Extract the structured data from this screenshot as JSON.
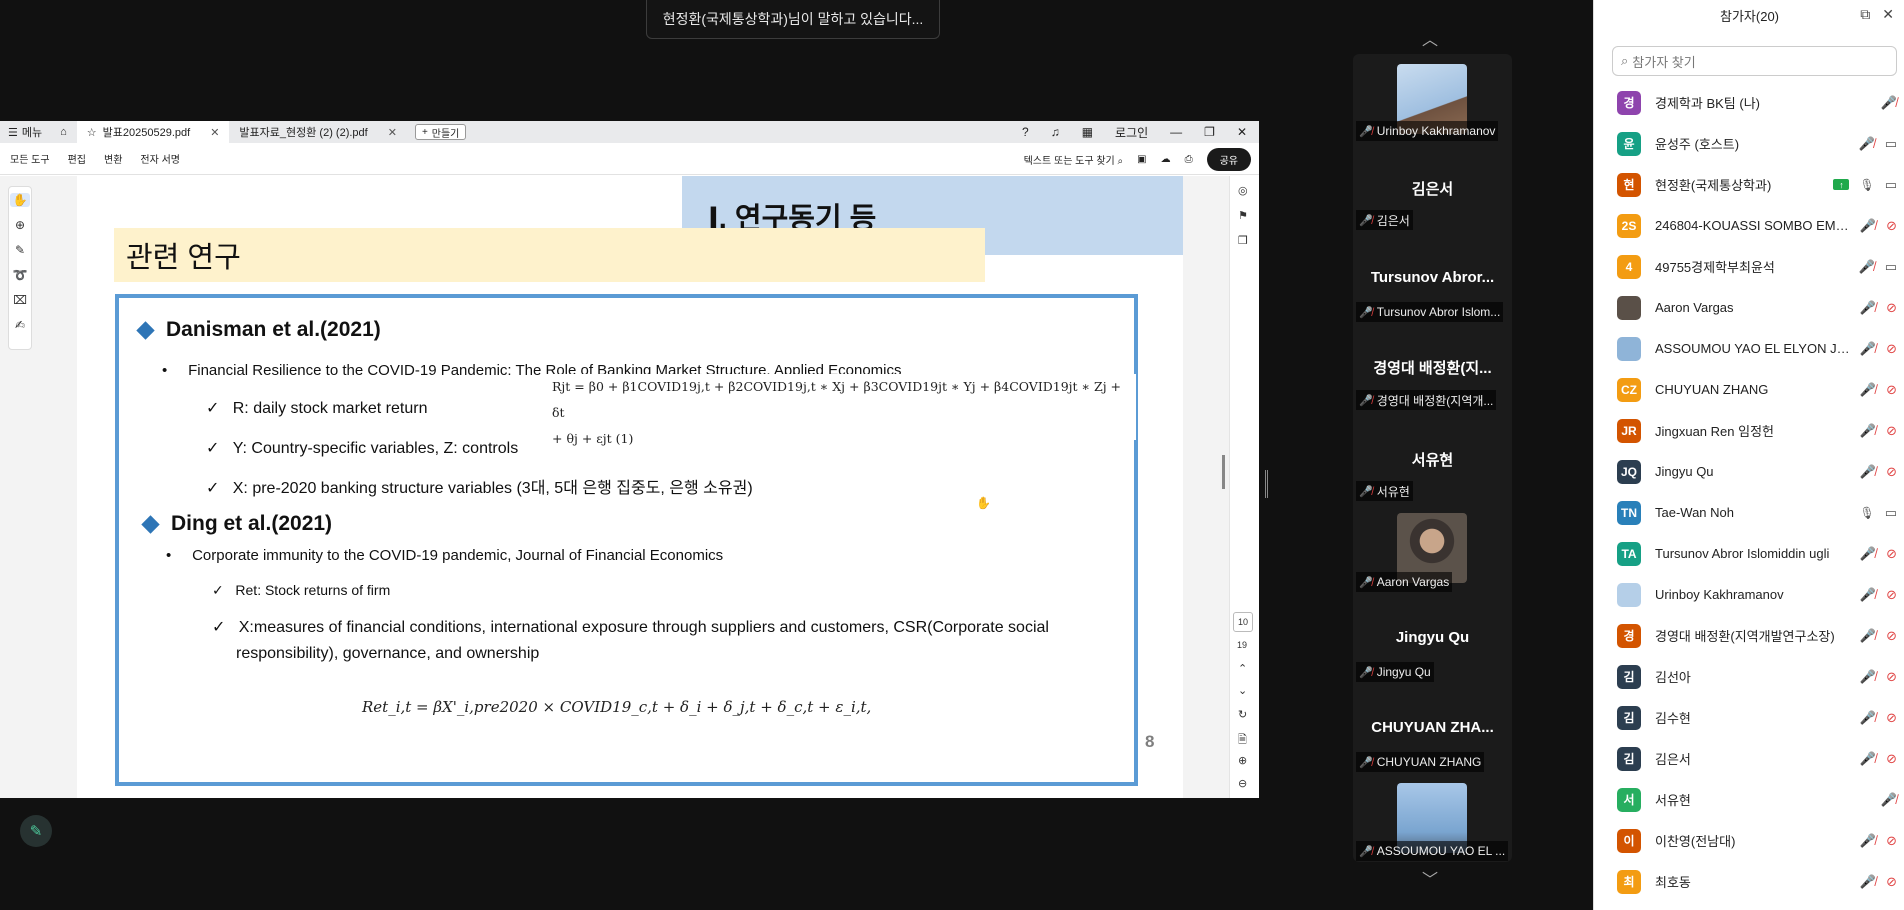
{
  "speaking_banner": "현정환(국제통상학과)님이 말하고 있습니다...",
  "pdf": {
    "menu_label": "메뉴",
    "tabs": [
      {
        "label": "발표20250529.pdf"
      },
      {
        "label": "발표자료_현정환 (2) (2).pdf"
      }
    ],
    "new_tab_label": "만들기",
    "login_label": "로그인",
    "toolbar_items": [
      "모든 도구",
      "편집",
      "변환",
      "전자 서명"
    ],
    "search_label": "텍스트 또는 도구 찾기",
    "share_label": "공유",
    "current_page": "10",
    "total_pages": "19"
  },
  "slide": {
    "title": "Ⅰ. 연구동기 등",
    "subtitle": "관련 연구",
    "section1_heading": "Danisman et al.(2021)",
    "section1_bullet": "Financial Resilience to the COVID-19 Pandemic: The Role of Banking Market Structure, Applied Economics",
    "section1_checks": [
      "R: daily stock market return",
      "Y: Country-specific variables,  Z: controls",
      "X: pre-2020 banking structure variables (3대, 5대 은행 집중도, 은행 소유권)"
    ],
    "equation_line1": "Rjt = β0 + β1COVID19j,t + β2COVID19j,t ∗ Xj + β3COVID19jt ∗ Yj + β4COVID19jt ∗ Zj + δt",
    "equation_line2": "+ θj + εjt   (1)",
    "section2_heading": "Ding et al.(2021)",
    "section2_bullet": "Corporate immunity to the COVID-19 pandemic, Journal of Financial Economics",
    "section2_check1": "Ret: Stock returns of firm",
    "section2_check2_a": "X:measures of financial conditions, international exposure through suppliers and customers, CSR(Corporate social",
    "section2_check2_b": "responsibility), governance, and ownership",
    "formula": "Ret_i,t = βX'_i,pre2020 × COVID19_c,t + δ_i + δ_j,t + δ_c,t + ε_i,t,",
    "page_number": "8"
  },
  "video_strip": [
    {
      "display_name": "",
      "label": "Urinboy Kakhramanov",
      "has_video": true,
      "thumb_color": "#b5cfe8"
    },
    {
      "display_name": "김은서",
      "label": "김은서",
      "has_video": false
    },
    {
      "display_name": "Tursunov  Abror...",
      "label": "Tursunov Abror Islom...",
      "has_video": false
    },
    {
      "display_name": "경영대 배정환(지...",
      "label": "경영대 배정환(지역개...",
      "has_video": false
    },
    {
      "display_name": "서유현",
      "label": "서유현",
      "has_video": false
    },
    {
      "display_name": "",
      "label": "Aaron Vargas",
      "has_video": true,
      "thumb_color": "#4a4038"
    },
    {
      "display_name": "Jingyu Qu",
      "label": "Jingyu Qu",
      "has_video": false
    },
    {
      "display_name": "CHUYUAN  ZHA...",
      "label": "CHUYUAN ZHANG",
      "has_video": false
    },
    {
      "display_name": "",
      "label": "ASSOUMOU YAO EL ...",
      "has_video": true,
      "thumb_color": "#8fb4d8"
    }
  ],
  "participants_panel": {
    "title": "참가자(20)",
    "search_placeholder": "참가자 찾기",
    "participants": [
      {
        "initial": "경",
        "name": "경제학과 BK팀 (나)",
        "color": "#8e44ad",
        "mic": "off",
        "cam": "none"
      },
      {
        "initial": "윤",
        "name": "윤성주 (호스트)",
        "color": "#16a085",
        "mic": "off",
        "cam": "on"
      },
      {
        "initial": "현",
        "name": "현정환(국제통상학과)",
        "color": "#d35400",
        "mic": "on",
        "cam": "on",
        "sharing": true
      },
      {
        "initial": "2S",
        "name": "246804-KOUASSI SOMBO EMMA...",
        "color": "#f39c12",
        "mic": "off",
        "cam": "off"
      },
      {
        "initial": "4",
        "name": "49755경제학부최윤석",
        "color": "#f39c12",
        "mic": "off",
        "cam": "on"
      },
      {
        "initial": "",
        "name": "Aaron Vargas",
        "color": "#5a5048",
        "mic": "off",
        "cam": "off"
      },
      {
        "initial": "",
        "name": "ASSOUMOU YAO EL ELYON JEA...",
        "color": "#8fb4d8",
        "mic": "off",
        "cam": "off"
      },
      {
        "initial": "CZ",
        "name": "CHUYUAN ZHANG",
        "color": "#f39c12",
        "mic": "off",
        "cam": "off"
      },
      {
        "initial": "JR",
        "name": "Jingxuan Ren   임정헌",
        "color": "#d35400",
        "mic": "off",
        "cam": "off"
      },
      {
        "initial": "JQ",
        "name": "Jingyu Qu",
        "color": "#2c3e50",
        "mic": "off",
        "cam": "off"
      },
      {
        "initial": "TN",
        "name": "Tae-Wan Noh",
        "color": "#2980b9",
        "mic": "on",
        "cam": "on"
      },
      {
        "initial": "TA",
        "name": "Tursunov Abror Islomiddin ugli",
        "color": "#16a085",
        "mic": "off",
        "cam": "off"
      },
      {
        "initial": "",
        "name": "Urinboy Kakhramanov",
        "color": "#b5cfe8",
        "mic": "off",
        "cam": "off"
      },
      {
        "initial": "경",
        "name": "경영대 배정환(지역개발연구소장)",
        "color": "#d35400",
        "mic": "off",
        "cam": "off"
      },
      {
        "initial": "김",
        "name": "김선아",
        "color": "#2c3e50",
        "mic": "off",
        "cam": "off"
      },
      {
        "initial": "김",
        "name": "김수현",
        "color": "#2c3e50",
        "mic": "off",
        "cam": "off"
      },
      {
        "initial": "김",
        "name": "김은서",
        "color": "#2c3e50",
        "mic": "off",
        "cam": "off"
      },
      {
        "initial": "서",
        "name": "서유현",
        "color": "#27ae60",
        "mic": "off",
        "cam": "none"
      },
      {
        "initial": "이",
        "name": "이찬영(전남대)",
        "color": "#d35400",
        "mic": "off",
        "cam": "off"
      },
      {
        "initial": "최",
        "name": "최호동",
        "color": "#f39c12",
        "mic": "off",
        "cam": "off"
      }
    ]
  }
}
